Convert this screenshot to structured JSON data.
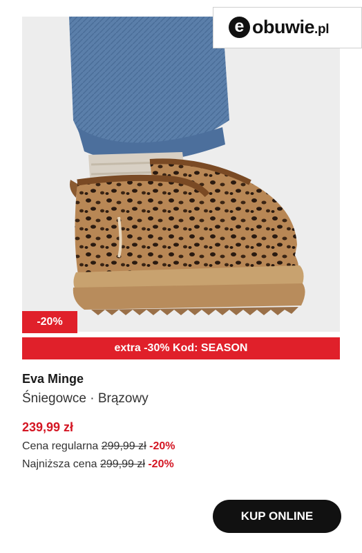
{
  "logo": {
    "mark": "e",
    "name": "obuwie",
    "tld": ".pl"
  },
  "image": {
    "subject": "leopard-print platform snow boots"
  },
  "badge": {
    "discount": "-20%"
  },
  "promo": {
    "text": "extra -30% Kod: SEASON"
  },
  "product": {
    "brand": "Eva Minge",
    "subtitle": "Śniegowce · Brązowy",
    "price": "239,99 zł",
    "regular_label": "Cena regularna",
    "regular_price": "299,99 zł",
    "regular_discount": "-20%",
    "lowest_label": "Najniższa cena",
    "lowest_price": "299,99 zł",
    "lowest_discount": "-20%"
  },
  "cta": {
    "label": "KUP ONLINE"
  },
  "colors": {
    "accent": "#e0202a",
    "price": "#d41623",
    "button": "#111111"
  }
}
